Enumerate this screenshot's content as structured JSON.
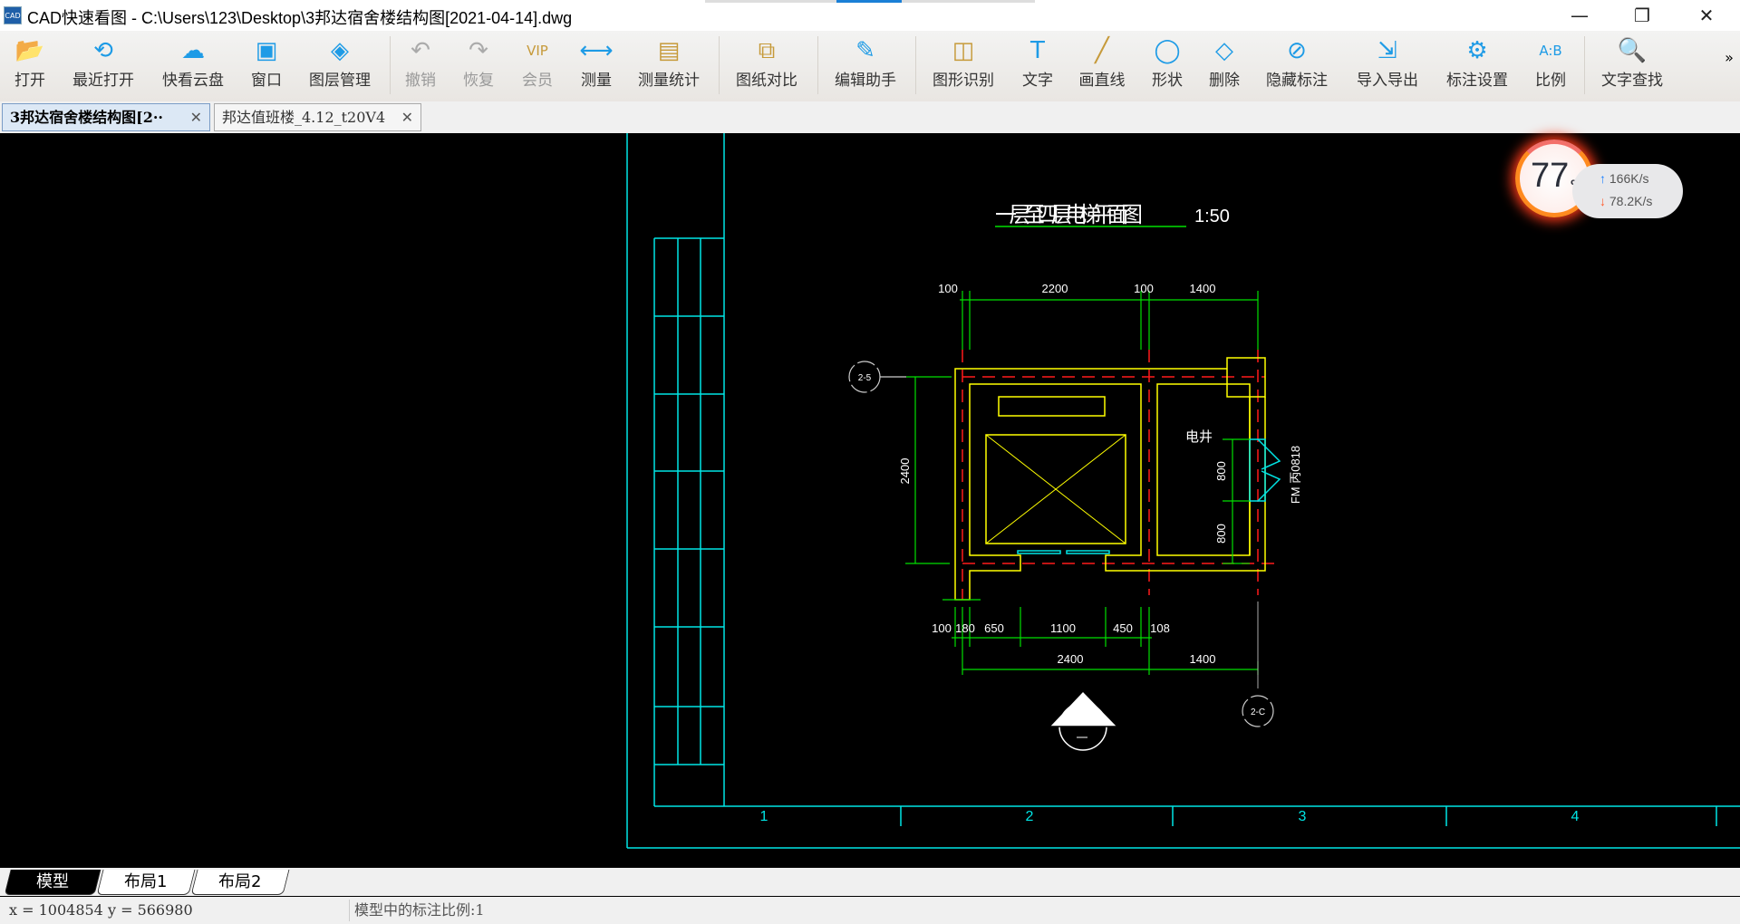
{
  "window": {
    "app_icon": "CAD",
    "title": "CAD快速看图 - C:\\Users\\123\\Desktop\\3邦达宿舍楼结构图[2021-04-14].dwg",
    "minimize": "—",
    "restore": "❐",
    "close": "✕"
  },
  "toolbar": {
    "items": [
      {
        "label": "打开",
        "icon": "folder-open",
        "glyph": "📂",
        "color": "#1e9be6"
      },
      {
        "label": "最近打开",
        "icon": "history",
        "glyph": "⟲",
        "color": "#1e9be6"
      },
      {
        "label": "快看云盘",
        "icon": "cloud",
        "glyph": "☁",
        "color": "#1e9be6"
      },
      {
        "label": "窗口",
        "icon": "window",
        "glyph": "▣",
        "color": "#1e9be6"
      },
      {
        "label": "图层管理",
        "icon": "layers",
        "glyph": "◈",
        "color": "#1e9be6"
      },
      {
        "label": "撤销",
        "icon": "undo",
        "glyph": "↶",
        "color": "#aaa",
        "disabled": true
      },
      {
        "label": "恢复",
        "icon": "redo",
        "glyph": "↷",
        "color": "#aaa",
        "disabled": true
      },
      {
        "label": "会员",
        "icon": "vip",
        "glyph": "VIP",
        "color": "#c69a3a",
        "disabled": true
      },
      {
        "label": "测量",
        "icon": "ruler",
        "glyph": "⟷",
        "color": "#1e9be6"
      },
      {
        "label": "测量统计",
        "icon": "measure-stats",
        "glyph": "▤",
        "color": "#c69a3a"
      },
      {
        "label": "图纸对比",
        "icon": "compare",
        "glyph": "⧉",
        "color": "#c69a3a"
      },
      {
        "label": "编辑助手",
        "icon": "cad-edit",
        "glyph": "✎",
        "color": "#1e9be6"
      },
      {
        "label": "图形识别",
        "icon": "shape-recognize",
        "glyph": "◫",
        "color": "#c69a3a"
      },
      {
        "label": "文字",
        "icon": "text",
        "glyph": "T",
        "color": "#1e9be6"
      },
      {
        "label": "画直线",
        "icon": "line",
        "glyph": "╱",
        "color": "#c69a3a"
      },
      {
        "label": "形状",
        "icon": "shapes",
        "glyph": "◯",
        "color": "#1e9be6"
      },
      {
        "label": "删除",
        "icon": "eraser",
        "glyph": "◇",
        "color": "#1e9be6"
      },
      {
        "label": "隐藏标注",
        "icon": "eye-hidden",
        "glyph": "⊘",
        "color": "#1e9be6"
      },
      {
        "label": "导入导出",
        "icon": "import-export",
        "glyph": "⇲",
        "color": "#1e9be6"
      },
      {
        "label": "标注设置",
        "icon": "annotation-settings",
        "glyph": "⚙",
        "color": "#1e9be6"
      },
      {
        "label": "比例",
        "icon": "scale",
        "glyph": "A:B",
        "color": "#1e9be6"
      },
      {
        "label": "文字查找",
        "icon": "text-search",
        "glyph": "🔍",
        "color": "#1e9be6"
      }
    ],
    "more": "»"
  },
  "doc_tabs": [
    {
      "label": "3邦达宿舍楼结构图[2··",
      "active": true
    },
    {
      "label": "邦达值班楼_4.12_t20V4",
      "active": false
    }
  ],
  "tab_close": "✕",
  "drawing": {
    "title": "一层至四层电梯平面图",
    "scale": "1:50",
    "top_dims": [
      "100",
      "2200",
      "100",
      "1400"
    ],
    "left_dim": "2400",
    "right_dims": [
      "800",
      "800"
    ],
    "room_label": "电井",
    "door_label": "FM 丙0818",
    "bottom_dims": [
      "100",
      "180",
      "650",
      "1100",
      "450",
      "108"
    ],
    "bottom_dims2": [
      "2400",
      "1400"
    ],
    "axis_left": "2-5",
    "axis_right": "2-C",
    "frame_numbers": [
      "1",
      "2",
      "3",
      "4"
    ]
  },
  "network_widget": {
    "percent": "77",
    "unit": "%",
    "upload": "166K/s",
    "download": "78.2K/s",
    "ring_color": "#ff8a1f"
  },
  "layout_tabs": [
    {
      "label": "模型",
      "active": true
    },
    {
      "label": "布局1"
    },
    {
      "label": "布局2"
    }
  ],
  "status": {
    "coords": "x = 1004854 y = 566980",
    "annotation_scale": "模型中的标注比例:1"
  }
}
